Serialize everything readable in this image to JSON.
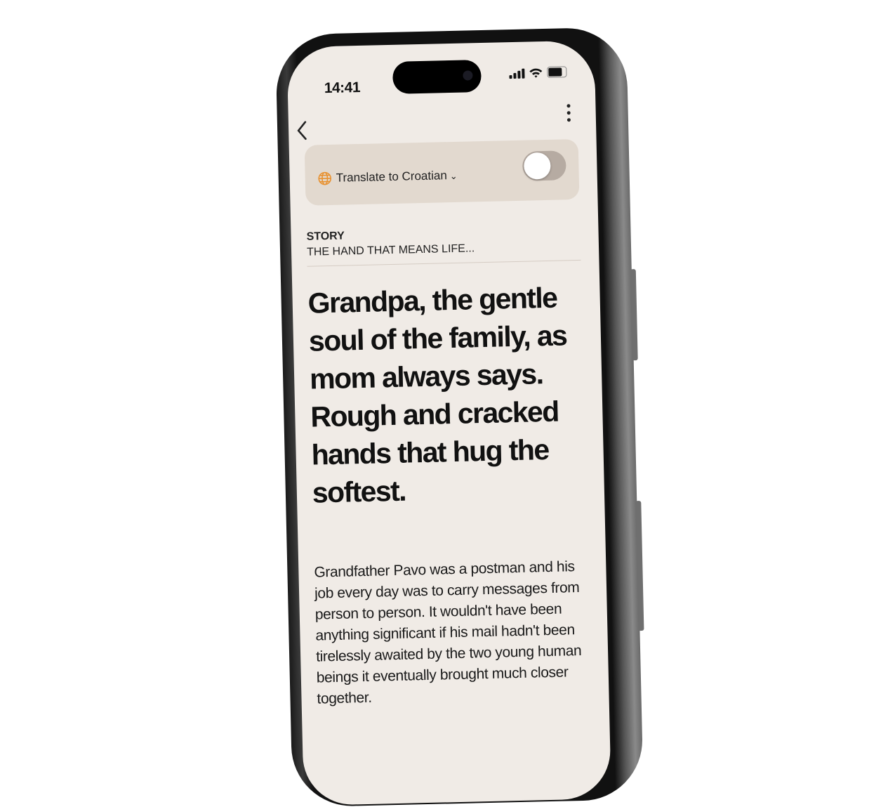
{
  "status_bar": {
    "time": "14:41",
    "icons": [
      "cellular-signal-icon",
      "wifi-icon",
      "battery-icon"
    ]
  },
  "nav": {
    "back_icon": "chevron-left-icon",
    "more_icon": "vertical-ellipsis-icon"
  },
  "translate": {
    "label": "Translate to Croatian",
    "icon": "globe-icon",
    "accent": "#e8912f",
    "enabled": false
  },
  "story": {
    "kicker": "STORY",
    "title": "THE HAND THAT MEANS LIFE...",
    "headline": "Grandpa, the gentle soul of the family, as mom always says. Rough and cracked hands that hug the softest.",
    "body": "Grandfather Pavo was a postman and his job every day was to carry messages from person to person. It wouldn't have been anything significant if his mail hadn't been tirelessly awaited by the two young human beings it eventually brought much closer together."
  },
  "colors": {
    "screen_bg": "#f0ebe6",
    "translate_bg": "#e2d9cf",
    "toggle_off": "#b6aba2"
  }
}
